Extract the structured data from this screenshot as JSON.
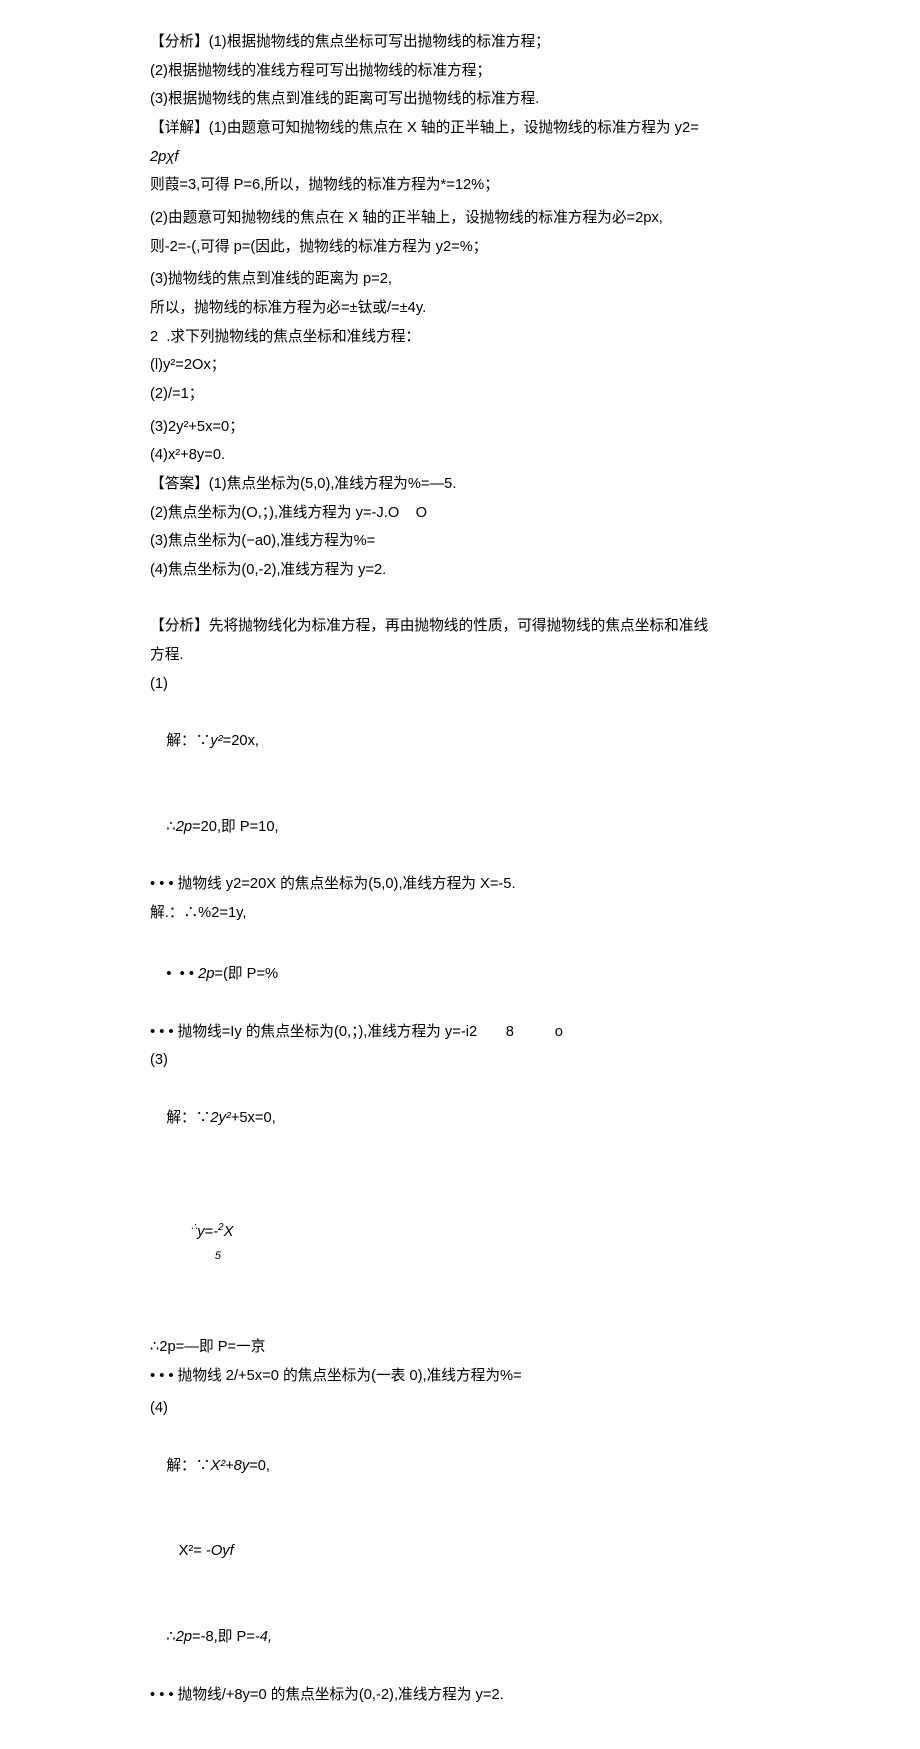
{
  "lines": {
    "l1": "【分析】(1)根据抛物线的焦点坐标可写出抛物线的标准方程；",
    "l2": "(2)根据抛物线的准线方程可写出抛物线的标准方程；",
    "l3": "(3)根据抛物线的焦点到准线的距离可写出抛物线的标准方程.",
    "l4": "【详解】(1)由题意可知抛物线的焦点在 X 轴的正半轴上，设抛物线的标准方程为 y2=",
    "l5": "2pχf",
    "l6": "则葭=3,可得 P=6,所以，抛物线的标准方程为*=12%；",
    "l7": "(2)由题意可知抛物线的焦点在 X 轴的正半轴上，设抛物线的标准方程为必=2px,",
    "l8": "则-2=-(,可得 p=(因此，抛物线的标准方程为 y2=%；",
    "l9": "(3)抛物线的焦点到准线的距离为 p=2,",
    "l10": "所以，抛物线的标准方程为必=±钛或/=±4y.",
    "l11": "2  .求下列抛物线的焦点坐标和准线方程：",
    "l12": "(l)y²=2Ox；",
    "l13": "(2)/=1；",
    "l14": "(3)2y²+5x=0；",
    "l15": "(4)x²+8y=0.",
    "l16": "【答案】(1)焦点坐标为(5,0),准线方程为%=—5.",
    "l17": "(2)焦点坐标为(O,；),准线方程为 y=-J.O    O",
    "l18": "(3)焦点坐标为(−a0),准线方程为%=",
    "l19": "(4)焦点坐标为(0,-2),准线方程为 y=2.",
    "l20": "【分析】先将抛物线化为标准方程，再由抛物线的性质，可得抛物线的焦点坐标和准线",
    "l21": "方程.",
    "l22": "(1)",
    "l23_a": "解：∵",
    "l23_b": "y²",
    "l23_c": "=20x,",
    "l24_a": "∴",
    "l24_b": "2p",
    "l24_c": "=20,即 P=10,",
    "l25": "• • • 抛物线 y2=20X 的焦点坐标为(5,0),准线方程为 X=-5.",
    "l26": "解.：∴%2=1y,",
    "l27_a": "•  • • ",
    "l27_b": "2p",
    "l27_c": "=(即 P=%",
    "l28": "• • • 抛物线=Iy 的焦点坐标为(0,；),准线方程为 y=-i2       8          o",
    "l29": "(3)",
    "l30_a": "解：∵",
    "l30_b": "2y²",
    "l30_c": "+5x=0,",
    "l31_pre": "∴",
    "l31_y": "y=-",
    "l31_two": "2",
    "l31_x": "X",
    "l31_five": "5",
    "l32": "∴2p=—即 P=一京",
    "l33": "• • • 抛物线 2/+5x=0 的焦点坐标为(一表 0),准线方程为%=",
    "l34": "(4)",
    "l35_a": "解：∵",
    "l35_b": "X²+8y",
    "l35_c": "=0,",
    "l36_a": "   X²=",
    "l36_b": " -Oyf",
    "l37_a": "∴",
    "l37_b": "2p",
    "l37_c": "=-8,即 P=",
    "l37_d": "-4,",
    "l38": "• • • 抛物线/+8y=0 的焦点坐标为(0,-2),准线方程为 y=2."
  }
}
